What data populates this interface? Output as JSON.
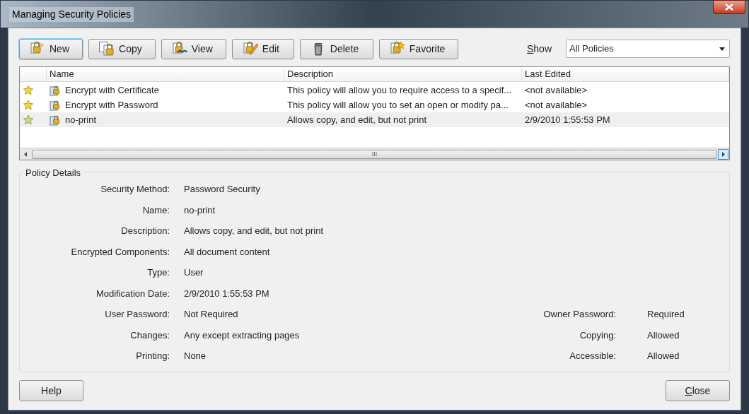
{
  "window": {
    "title": "Managing Security Policies"
  },
  "toolbar": [
    {
      "label": "New",
      "kind": "new",
      "focused": true
    },
    {
      "label": "Copy",
      "kind": "copy",
      "focused": false
    },
    {
      "label": "View",
      "kind": "view",
      "focused": false
    },
    {
      "label": "Edit",
      "kind": "edit",
      "focused": false
    },
    {
      "label": "Delete",
      "kind": "delete",
      "focused": false
    },
    {
      "label": "Favorite",
      "kind": "favorite",
      "focused": false
    }
  ],
  "show": {
    "label": "Show",
    "mnemonic_underlined": true,
    "value": "All Policies"
  },
  "table": {
    "columns": [
      "Name",
      "Description",
      "Last Edited"
    ],
    "rows": [
      {
        "favorite": true,
        "selected": false,
        "name": "Encrypt with Certificate",
        "description": "This policy will allow you to require access to a specif...",
        "last_edited": "<not available>"
      },
      {
        "favorite": true,
        "selected": false,
        "name": "Encrypt with Password",
        "description": "This policy will allow you to set an open or modify pa...",
        "last_edited": "<not available>"
      },
      {
        "favorite": true,
        "selected": true,
        "name": "no-print",
        "description": "Allows copy, and edit, but not print",
        "last_edited": "2/9/2010 1:55:53 PM"
      }
    ]
  },
  "details": {
    "title": "Policy Details",
    "left": [
      {
        "label": "Security Method:",
        "value": "Password Security"
      },
      {
        "label": "Name:",
        "value": "no-print"
      },
      {
        "label": "Description:",
        "value": "Allows copy, and edit, but not print"
      },
      {
        "label": "Encrypted Components:",
        "value": "All document content"
      },
      {
        "label": "Type:",
        "value": "User"
      },
      {
        "label": "Modification Date:",
        "value": "2/9/2010 1:55:53 PM"
      },
      {
        "label": "User Password:",
        "value": "Not Required"
      },
      {
        "label": "Changes:",
        "value": "Any except extracting pages"
      },
      {
        "label": "Printing:",
        "value": "None"
      }
    ],
    "right": [
      {
        "label": "Owner Password:",
        "value": "Required"
      },
      {
        "label": "Copying:",
        "value": "Allowed"
      },
      {
        "label": "Accessible:",
        "value": "Allowed"
      }
    ]
  },
  "footer": {
    "help": {
      "label": "Help",
      "mnemonic_underlined": false
    },
    "close": {
      "label": "Close",
      "mnemonic_underlined": true
    }
  }
}
